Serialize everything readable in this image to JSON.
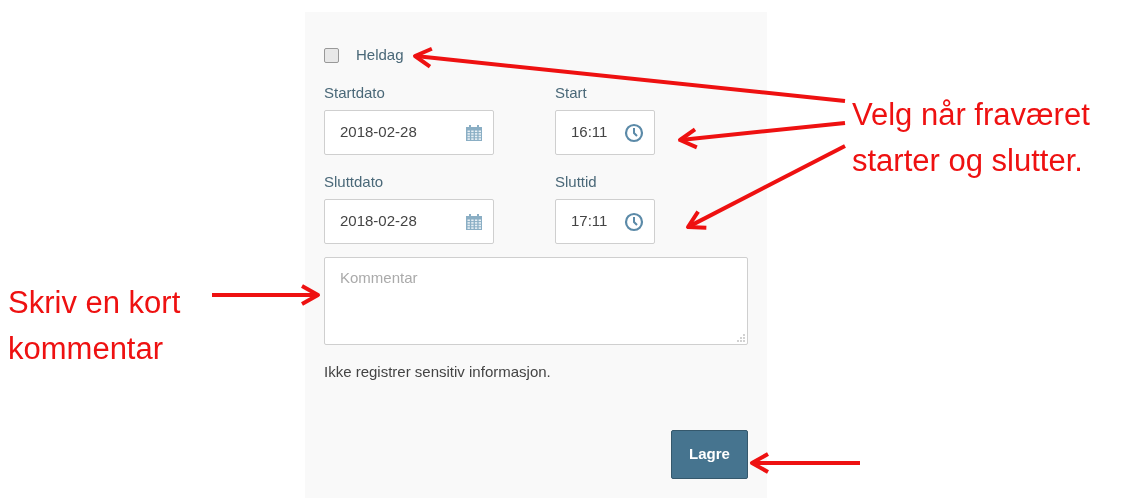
{
  "form": {
    "all_day": {
      "label": "Heldag",
      "checked": false
    },
    "fields": [
      {
        "label": "Startdato",
        "value": "2018-02-28",
        "kind": "date"
      },
      {
        "label": "Start",
        "value": "16:11",
        "kind": "time"
      },
      {
        "label": "Sluttdato",
        "value": "2018-02-28",
        "kind": "date"
      },
      {
        "label": "Sluttid",
        "value": "17:11",
        "kind": "time"
      }
    ],
    "comment": {
      "placeholder": "Kommentar"
    },
    "note": "Ikke registrer sensitiv informasjon.",
    "save_button": "Lagre"
  },
  "annotations": [
    "Velg når fraværet starter og slutter.",
    "Skriv en kort kommentar"
  ]
}
